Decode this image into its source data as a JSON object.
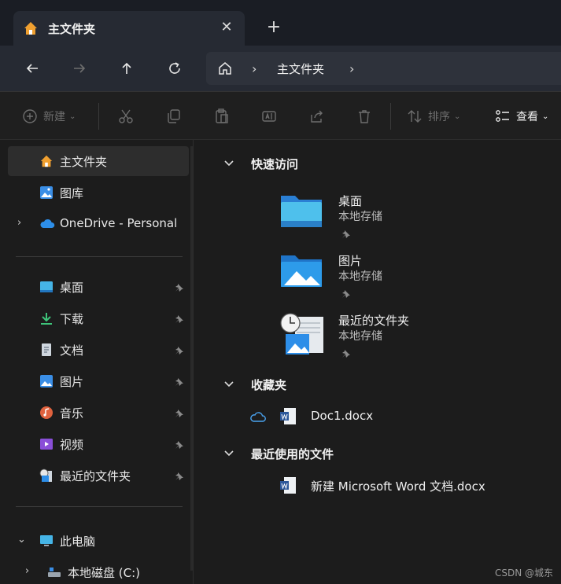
{
  "tab": {
    "title": "主文件夹",
    "close_glyph": "✕",
    "new_tab_glyph": "+"
  },
  "address": {
    "crumb": "主文件夹",
    "separator": "›"
  },
  "commands": {
    "new_label": "新建",
    "sort_label": "排序",
    "view_label": "查看"
  },
  "sidebar": {
    "items": [
      {
        "label": "主文件夹",
        "icon": "home-icon"
      },
      {
        "label": "图库",
        "icon": "gallery-icon"
      },
      {
        "label": "OneDrive - Personal",
        "icon": "cloud-icon"
      },
      {
        "label": "桌面",
        "icon": "desktop-icon"
      },
      {
        "label": "下载",
        "icon": "download-icon"
      },
      {
        "label": "文档",
        "icon": "document-icon"
      },
      {
        "label": "图片",
        "icon": "pictures-icon"
      },
      {
        "label": "音乐",
        "icon": "music-icon"
      },
      {
        "label": "视频",
        "icon": "video-icon"
      },
      {
        "label": "最近的文件夹",
        "icon": "recent-folder-icon"
      },
      {
        "label": "此电脑",
        "icon": "this-pc-icon"
      },
      {
        "label": "本地磁盘 (C:)",
        "icon": "drive-icon"
      }
    ]
  },
  "main": {
    "quick_access": {
      "title": "快速访问",
      "items": [
        {
          "name": "桌面",
          "sub": "本地存储"
        },
        {
          "name": "图片",
          "sub": "本地存储"
        },
        {
          "name": "最近的文件夹",
          "sub": "本地存储"
        }
      ]
    },
    "favorites": {
      "title": "收藏夹",
      "file": "Doc1.docx"
    },
    "recent": {
      "title": "最近使用的文件",
      "file": "新建 Microsoft Word 文档.docx"
    }
  },
  "watermark": "CSDN @城东",
  "colors": {
    "accent": "#4aa3f0",
    "folder_blue": "#2d8ee8",
    "home_orange": "#f0a030"
  }
}
